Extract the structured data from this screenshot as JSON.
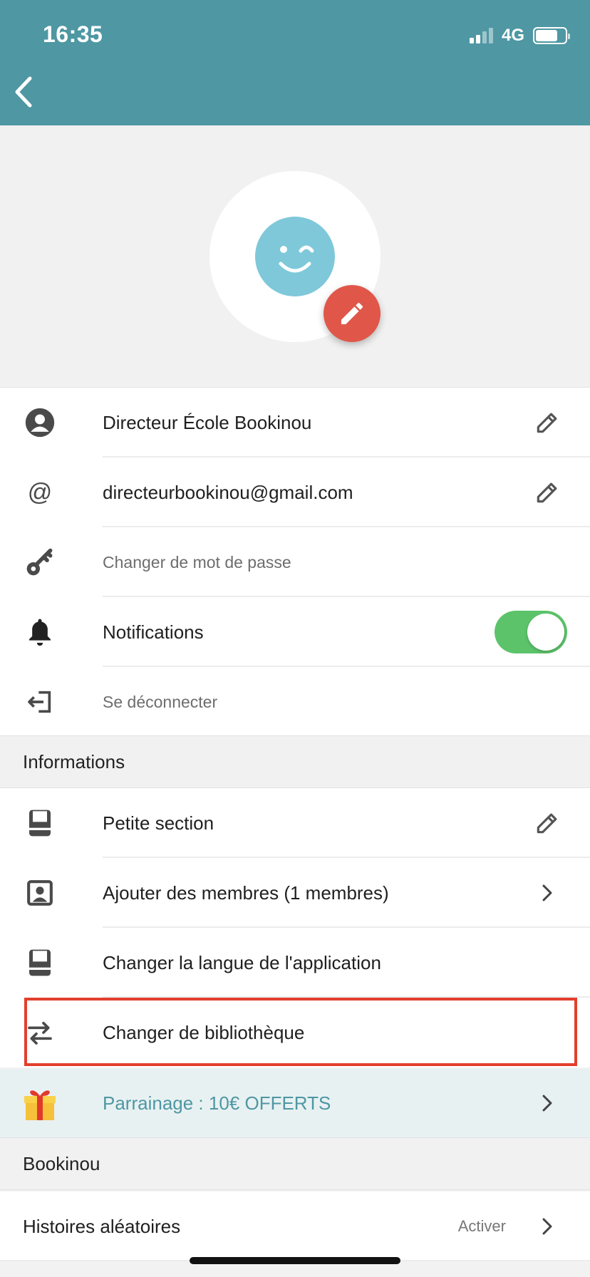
{
  "status_bar": {
    "time": "16:35",
    "network": "4G"
  },
  "profile": {
    "name": "Directeur  École  Bookinou",
    "email": "directeurbookinou@gmail.com",
    "change_password": "Changer de mot de passe",
    "notifications_label": "Notifications",
    "notifications_enabled": true,
    "logout": "Se déconnecter"
  },
  "informations": {
    "header": "Informations",
    "items": [
      {
        "label": "Petite section"
      },
      {
        "label": "Ajouter des membres (1 membres)"
      },
      {
        "label": "Changer la langue de l'application"
      },
      {
        "label": "Changer de bibliothèque"
      }
    ]
  },
  "referral": {
    "label": "Parrainage : 10€ OFFERTS"
  },
  "bookinou": {
    "header": "Bookinou",
    "random_stories": {
      "label": "Histoires aléatoires",
      "action": "Activer"
    }
  },
  "colors": {
    "header_bg": "#4e97a3",
    "accent_red": "#e0574a",
    "toggle_green": "#5cc36a",
    "highlight_red": "#e23f2c",
    "avatar_blue": "#7ec8da"
  },
  "icons": {
    "back": "chevron-left-icon",
    "edit_photo": "pencil-icon",
    "name": "account-circle-icon",
    "email": "at-sign-icon",
    "password": "key-icon",
    "notifications": "bell-icon",
    "logout": "logout-icon",
    "section": "book-icon",
    "members": "contact-portrait-icon",
    "language": "book-icon",
    "library": "swap-arrows-icon",
    "referral": "gift-icon",
    "row_edit": "pencil-outline-icon",
    "chevron": "chevron-right-icon"
  }
}
